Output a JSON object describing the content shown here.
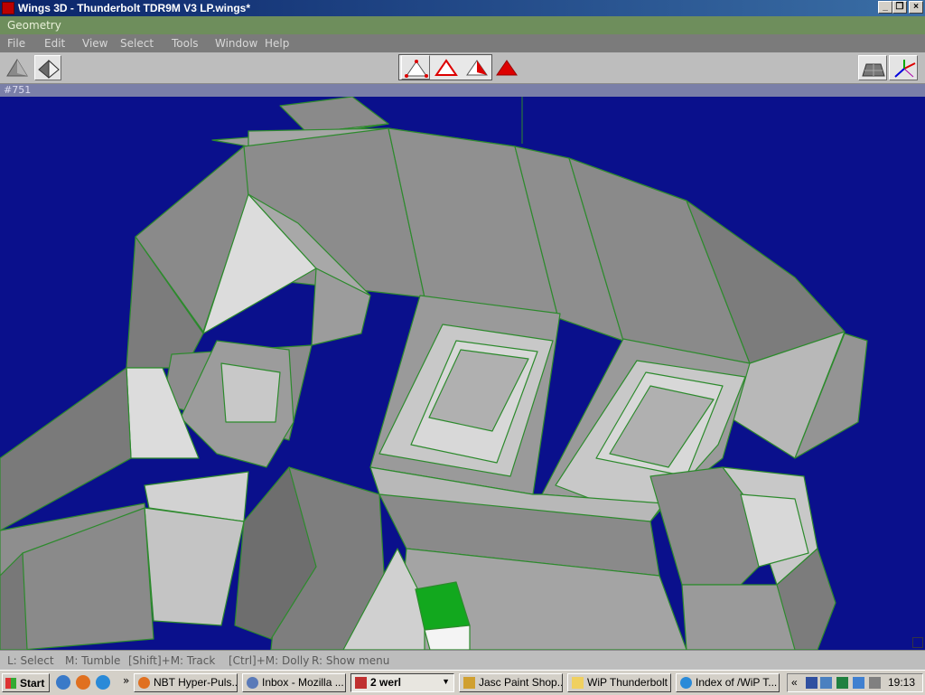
{
  "window": {
    "title": "Wings 3D - Thunderbolt TDR9M V3 LP.wings*"
  },
  "geometry_label": "Geometry",
  "menu": [
    "File",
    "Edit",
    "View",
    "Select",
    "Tools",
    "Window",
    "Help"
  ],
  "toolbar": {
    "left_icons": [
      "smooth-shaded-view-icon",
      "flat-shaded-view-icon"
    ],
    "select_modes": [
      "vertex-select-icon",
      "edge-select-icon",
      "face-select-icon",
      "body-select-icon"
    ],
    "right_icons": [
      "ground-plane-icon",
      "axes-icon"
    ]
  },
  "info": "#751",
  "status": {
    "l": "L: Select",
    "m": "M: Tumble",
    "shift_m": "[Shift]+M: Track",
    "ctrl_m": "[Ctrl]+M: Dolly",
    "r": "R: Show menu"
  },
  "taskbar": {
    "start": "Start",
    "overflow": "»",
    "tasks": [
      "NBT Hyper-Puls...",
      "Inbox - Mozilla ...",
      "2 werl",
      "Jasc Paint Shop...",
      "WiP Thunderbolt",
      "Index of /WiP T..."
    ],
    "tray_overflow": "«",
    "clock": "19:13"
  },
  "colors": {
    "viewport_bg": "#0a108c",
    "edge": "#2d8a2d",
    "selected_face": "#12a81e",
    "title_start": "#0a246a",
    "title_end": "#3a6ea5"
  }
}
